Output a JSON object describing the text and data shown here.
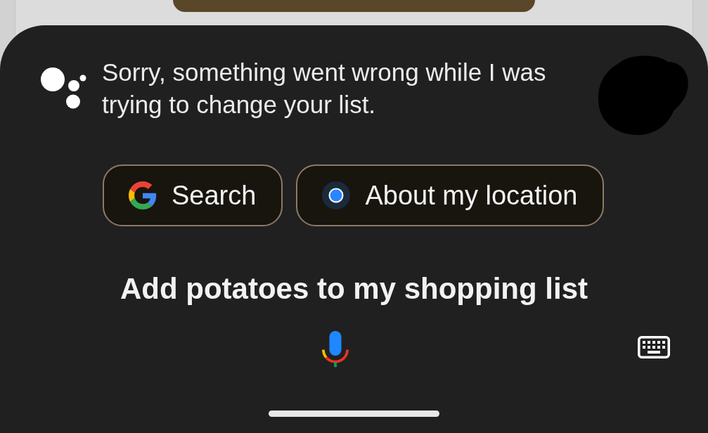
{
  "assistant_reply": {
    "text": "Sorry, something went wrong while I was trying to change your list."
  },
  "suggestion_chips": [
    {
      "kind": "search",
      "label": "Search"
    },
    {
      "kind": "location",
      "label": "About my location"
    }
  ],
  "query": {
    "text": "Add potatoes to my shopping list"
  }
}
